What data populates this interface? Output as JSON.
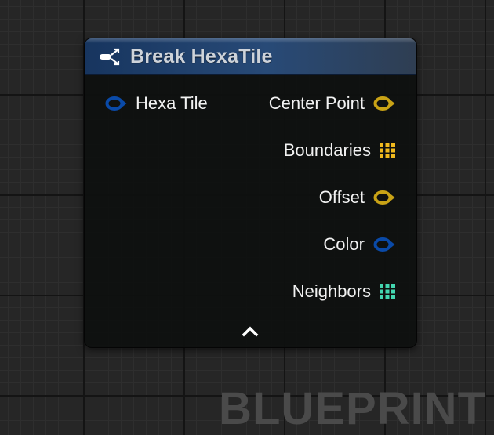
{
  "colors": {
    "background": "#262626",
    "node_body": "#0e100f",
    "header_start": "#17355f",
    "header_end": "#2f3e52",
    "struct_pin": "#0a4aa8",
    "vector_pin": "#c9a316",
    "boundaries_array": "#f0b91d",
    "neighbors_array": "#43d6b0",
    "text": "#f2f2f2"
  },
  "node": {
    "title": "Break HexaTile",
    "icon": "break-struct-icon",
    "inputs": [
      {
        "label": "Hexa Tile",
        "pin_type": "struct",
        "icon": "struct-pin-icon"
      }
    ],
    "outputs": [
      {
        "label": "Center Point",
        "pin_type": "vector",
        "icon": "vector-pin-icon"
      },
      {
        "label": "Boundaries",
        "pin_type": "array",
        "icon": "array-pin-icon"
      },
      {
        "label": "Offset",
        "pin_type": "vector",
        "icon": "vector-pin-icon"
      },
      {
        "label": "Color",
        "pin_type": "struct",
        "icon": "struct-pin-icon"
      },
      {
        "label": "Neighbors",
        "pin_type": "array",
        "icon": "array-pin-icon"
      }
    ],
    "collapse_icon": "chevron-up-icon"
  },
  "watermark": {
    "text": "BLUEPRINT"
  }
}
